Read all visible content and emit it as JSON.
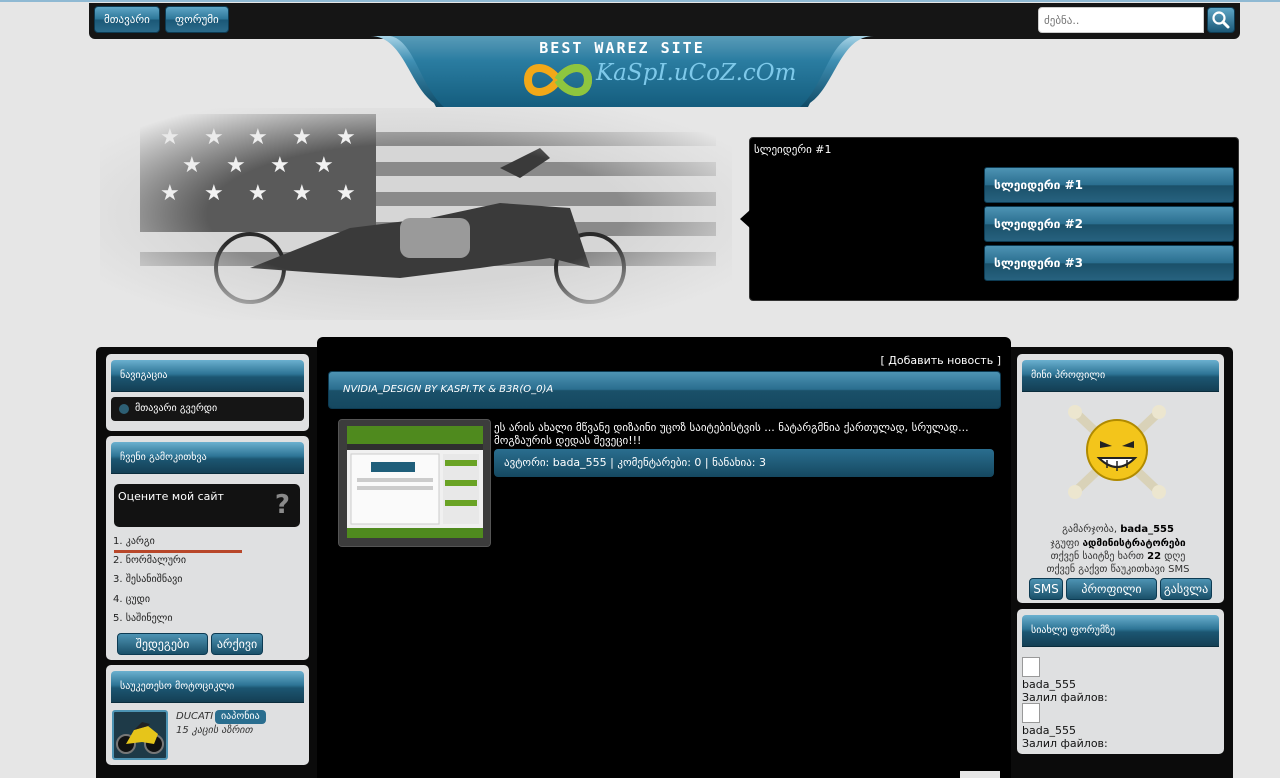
{
  "topnav": {
    "home": "მთავარი",
    "forum": "ფორუმი"
  },
  "search": {
    "placeholder": "ძებნა.."
  },
  "header": {
    "tagline": "BEST WAREZ SITE",
    "site_name": "KaSpI.uCoZ.cOm"
  },
  "slider": {
    "title": "სლეიდერი #1",
    "items": [
      "სლეიდერი #1",
      "სლეიდერი #2",
      "სლეიდერი #3"
    ]
  },
  "left": {
    "nav_title": "ნავიგაცია",
    "nav_items": [
      "მთავარი გვერდი"
    ],
    "poll_title": "ჩვენი გამოკითხვა",
    "poll_question": "Оцените мой сайт",
    "poll_options": [
      "1. კარგი",
      "2. ნორმალური",
      "3. შესანიშნავი",
      "4. ცუდი",
      "5. საშინელი"
    ],
    "poll_results": "შედეგები",
    "poll_archive": "არქივი",
    "bike_title": "საუკეთესო მოტოციკლი",
    "bike_name": "DUCATI",
    "bike_badge": "იაპონია",
    "bike_votes": "15 კაცის აზრით"
  },
  "news": {
    "add_link": "[ Добавить новость ]",
    "title": "NVIDIA_DESIGN BY KASPI.TK & B3R(O_0)A",
    "text": "ეს არის ახალი მწვანე დიზაინი უცოზ საიტებისტვის ... ნატარგმნია ქართულად, სრულად... მოგზაურის დედას შევეცი!!!",
    "meta": "ავტორი: bada_555 | კომენტარები: 0 | ნანახია: 3"
  },
  "right": {
    "profile_title": "მინი პროფილი",
    "greeting_label": "გამარჯობა,",
    "username": "bada_555",
    "group_label": "ჯგუფი",
    "group": "ადმინისტრატორები",
    "days_prefix": "თქვენ საიტზე ხართ",
    "days": "22",
    "days_suffix": "დღე",
    "sms_line": "თქვენ გაქვთ წაუკითხავი SMS",
    "btn_sms": "SMS",
    "btn_profile": "პროფილი",
    "btn_logout": "გასვლა",
    "forum_title": "სიახლე ფორუმზე",
    "forum_items": [
      {
        "user": "bada_555",
        "action": "Залил файлов:"
      },
      {
        "user": "bada_555",
        "action": "Залил файлов:"
      }
    ]
  },
  "colors": {
    "accent": "#2a6e8f",
    "frame": "#0b0b0b",
    "page_bg": "#e6e6e6"
  }
}
